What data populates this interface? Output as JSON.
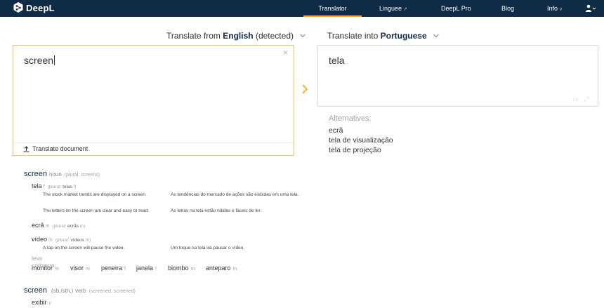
{
  "nav": {
    "brand": "DeepL",
    "items": [
      "Translator",
      "Linguee",
      "DeepL Pro",
      "Blog",
      "Info"
    ]
  },
  "colors": {
    "navbar": "#0f2b46",
    "accent": "#f5a623",
    "source_border": "#f2c14e"
  },
  "lang_from": {
    "prefix": "Translate from",
    "language": "English",
    "suffix": "(detected)"
  },
  "lang_to": {
    "prefix": "Translate into",
    "language": "Portuguese"
  },
  "source": {
    "text": "screen",
    "clear": "×",
    "translate_document": "Translate document"
  },
  "target": {
    "text": "tela"
  },
  "alternatives": {
    "title": "Alternatives:",
    "items": [
      "ecrã",
      "tela de visualização",
      "tela de projeção"
    ]
  },
  "dictionary": {
    "noun": {
      "word": "screen",
      "pos": "noun",
      "plural": "(plural: screens)",
      "tela": {
        "word": "tela",
        "gender": "f",
        "plural_label": "(plural:",
        "plural_word": "telas",
        "plural_gender": "f)"
      },
      "examples": [
        {
          "en": "The stock market trends are displayed on a screen.",
          "pt": "As tendências do mercado de ações são exibidas em uma tela."
        },
        {
          "en": "The letters on the screen are clear and easy to read.",
          "pt": "As letras na tela estão nítidas e fáceis de ler."
        }
      ],
      "ecra": {
        "word": "ecrã",
        "gender": "m",
        "plural_label": "(plural:",
        "plural_word": "ecrãs",
        "plural_gender": "m)"
      },
      "video": {
        "word": "vídeo",
        "gender": "m",
        "plural_label": "(plural:",
        "plural_word": "vídeos",
        "plural_gender": "m)"
      },
      "video_example": {
        "en": "A tap on the screen will pause the video.",
        "pt": "Um toque na tela irá pausar o vídeo."
      },
      "less_common": "less common:",
      "less_common_items": [
        {
          "word": "monitor",
          "g": "m"
        },
        {
          "word": "visor",
          "g": "m"
        },
        {
          "word": "peneira",
          "g": "f"
        },
        {
          "word": "janela",
          "g": "f"
        },
        {
          "word": "biombo",
          "g": "m"
        },
        {
          "word": "anteparo",
          "g": "m"
        }
      ]
    },
    "verb": {
      "word": "screen",
      "object": "(sb./sth.)",
      "pos": "verb",
      "forms": "(screened, screened)",
      "exibir": {
        "word": "exibir",
        "g": "v"
      }
    }
  }
}
